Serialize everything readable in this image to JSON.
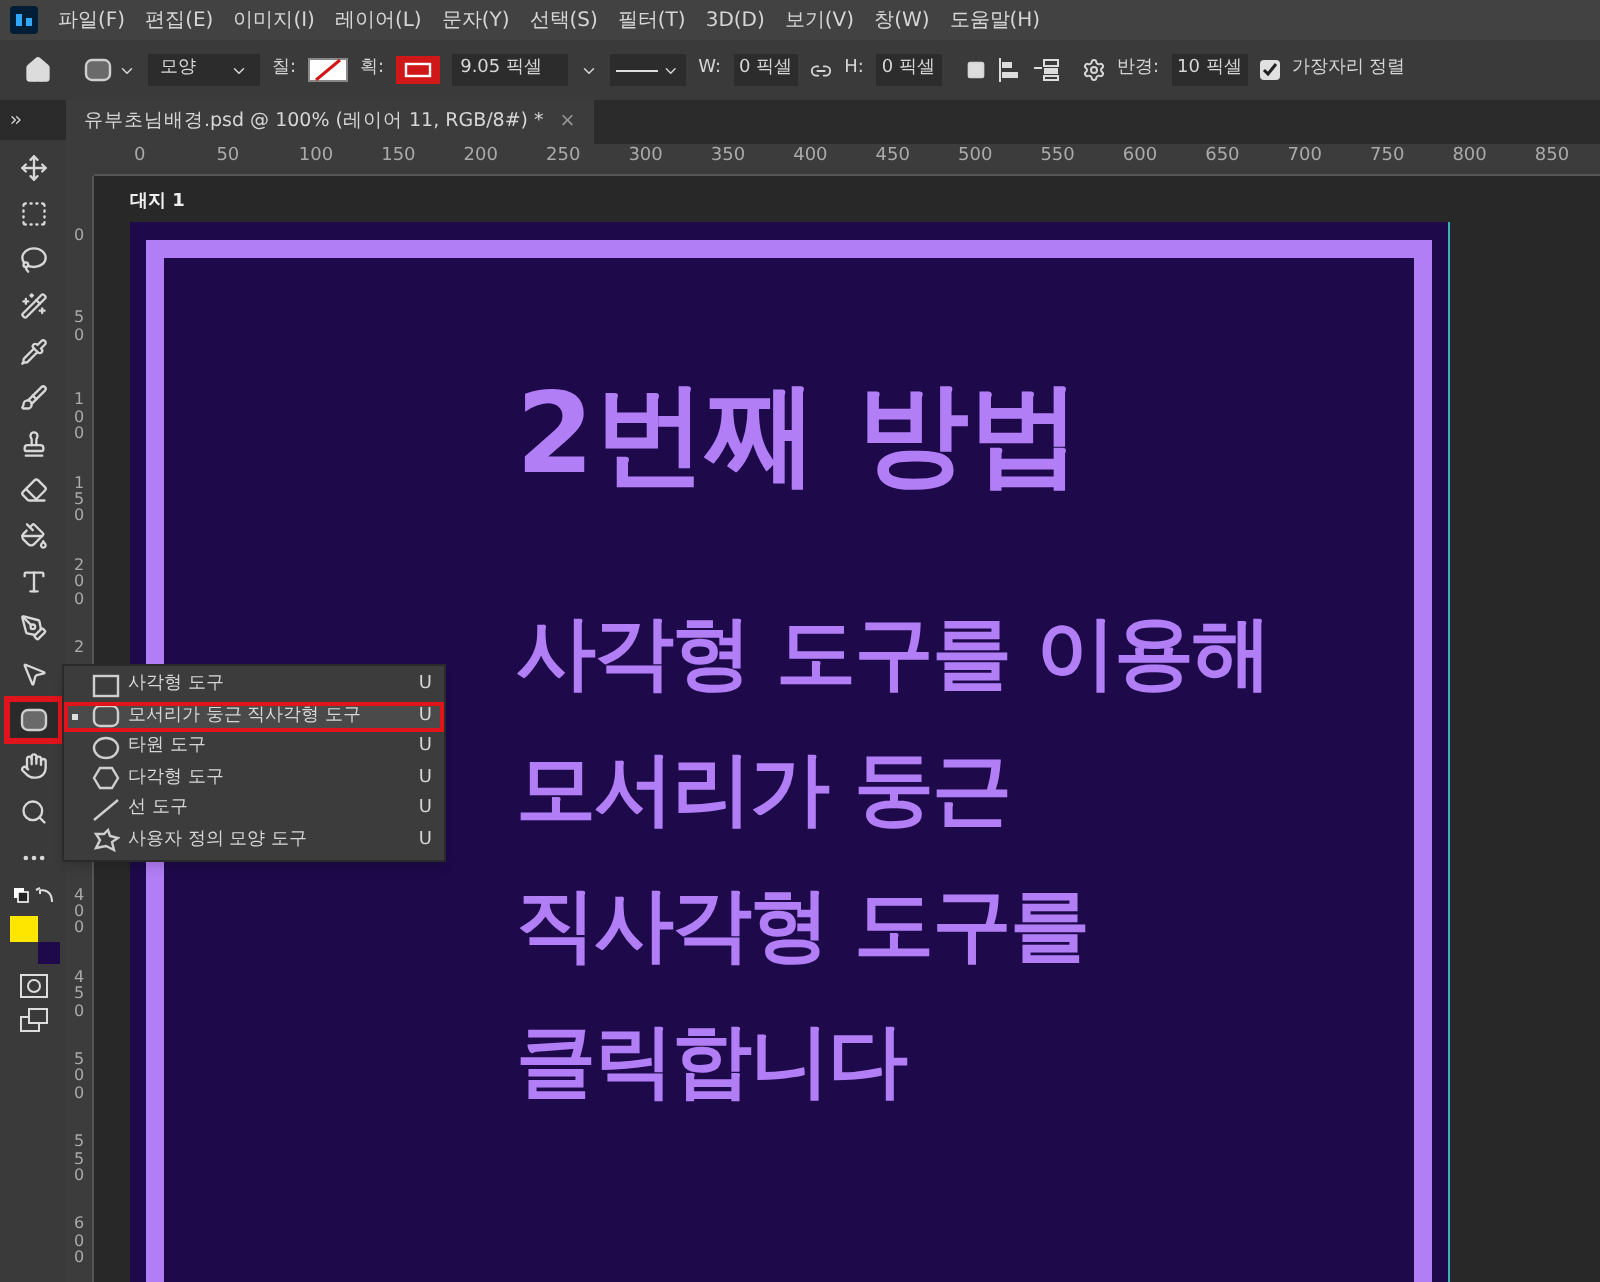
{
  "menu_bar": {
    "items": [
      "파일(F)",
      "편집(E)",
      "이미지(I)",
      "레이어(L)",
      "문자(Y)",
      "선택(S)",
      "필터(T)",
      "3D(D)",
      "보기(V)",
      "창(W)",
      "도움말(H)"
    ]
  },
  "options_bar": {
    "mode": "모양",
    "fill_label": "칠:",
    "stroke_label": "획:",
    "stroke_width": "9.05 픽셀",
    "w_label": "W:",
    "w_value": "0 픽셀",
    "h_label": "H:",
    "h_value": "0 픽셀",
    "radius_label": "반경:",
    "radius_value": "10 픽셀",
    "align_edges": {
      "label": "가장자리 정렬",
      "checked": true
    }
  },
  "document_tab": {
    "title": "유부초님배경.psd @ 100% (레이어 11, RGB/8#) *",
    "close": "×"
  },
  "horizontal_ruler": [
    "0",
    "50",
    "100",
    "150",
    "200",
    "250",
    "300",
    "350",
    "400",
    "450",
    "500",
    "550",
    "600",
    "650",
    "700",
    "750",
    "800",
    "850"
  ],
  "vertical_ruler": {
    "upper": [
      "0",
      "50",
      "100",
      "150",
      "200",
      "2"
    ],
    "lower": [
      "400",
      "450",
      "500",
      "550",
      "600"
    ]
  },
  "toolbar": {
    "tools": [
      {
        "selected": false,
        "highlighted": false
      },
      {
        "selected": false,
        "highlighted": false
      },
      {
        "selected": false,
        "highlighted": false
      },
      {
        "selected": false,
        "highlighted": false
      },
      {
        "selected": false,
        "highlighted": false
      },
      {
        "selected": false,
        "highlighted": false
      },
      {
        "selected": false,
        "highlighted": false
      },
      {
        "selected": false,
        "highlighted": false
      },
      {
        "selected": false,
        "highlighted": false
      },
      {
        "selected": false,
        "highlighted": false
      },
      {
        "selected": false,
        "highlighted": false
      },
      {
        "selected": false,
        "highlighted": false
      },
      {
        "selected": true,
        "highlighted": true
      },
      {
        "selected": false,
        "highlighted": false
      },
      {
        "selected": false,
        "highlighted": false
      },
      {
        "selected": false,
        "highlighted": false
      }
    ],
    "swatches": [
      {
        "kind": "foreground",
        "color": "#ffe600"
      },
      {
        "kind": "background",
        "color": "#1e0a4a"
      }
    ]
  },
  "flyout": {
    "items": [
      {
        "kind": "rectangle",
        "label": "사각형 도구",
        "shortcut": "U",
        "current": false,
        "highlighted": false
      },
      {
        "kind": "rounded",
        "label": "모서리가 둥근 직사각형 도구",
        "shortcut": "U",
        "current": true,
        "highlighted": true
      },
      {
        "kind": "ellipse",
        "label": "타원 도구",
        "shortcut": "U",
        "current": false,
        "highlighted": false
      },
      {
        "kind": "polygon",
        "label": "다각형 도구",
        "shortcut": "U",
        "current": false,
        "highlighted": false
      },
      {
        "kind": "line",
        "label": "선 도구",
        "shortcut": "U",
        "current": false,
        "highlighted": false
      },
      {
        "kind": "custom",
        "label": "사용자 정의 모양 도구",
        "shortcut": "U",
        "current": false,
        "highlighted": false
      }
    ]
  },
  "artboard": {
    "label": "대지 1",
    "title": "2번째 방법",
    "body": [
      "사각형 도구를 이용해",
      "모서리가 둥근",
      "직사각형 도구를",
      "클릭합니다"
    ]
  }
}
